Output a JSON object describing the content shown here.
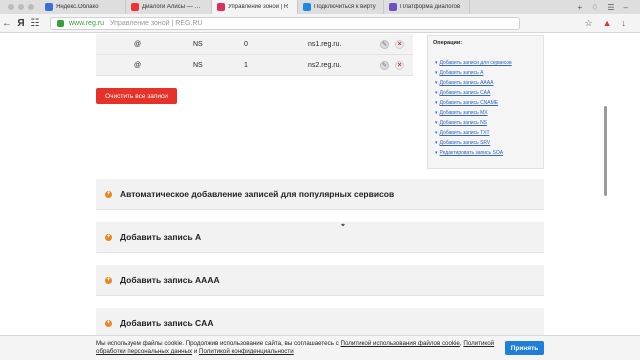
{
  "browser": {
    "tabs": [
      {
        "label": "Яндекс.Облако",
        "fav_color": "#3a6fd8"
      },
      {
        "label": "Диалоги Алисы — Обл",
        "fav_color": "#e33"
      },
      {
        "label": "Управление зоной | R",
        "fav_color": "#d9305c",
        "active": true
      },
      {
        "label": "Подключиться к вирту",
        "fav_color": "#1e88e5"
      },
      {
        "label": "Платформа диалогов",
        "fav_color": "#6a4fc8"
      }
    ],
    "url_domain": "www.reg.ru",
    "page_title": "Управление зоной | REG.RU",
    "yandex_logo": "Я"
  },
  "dns_records": [
    {
      "subdomain": "@",
      "type": "NS",
      "priority": "0",
      "value": "ns1.reg.ru."
    },
    {
      "subdomain": "@",
      "type": "NS",
      "priority": "1",
      "value": "ns2.reg.ru."
    }
  ],
  "clear_button": "Очистить все записи",
  "operations": {
    "title": "Операции:",
    "items": [
      "Добавить записи для сервисов",
      "Добавить запись A",
      "Добавить запись AAAA",
      "Добавить запись CAA",
      "Добавить запись CNAME",
      "Добавить запись MX",
      "Добавить запись NS",
      "Добавить запись TXT",
      "Добавить запись SRV",
      "Редактировать запись SOA"
    ]
  },
  "sections": [
    {
      "title": "Автоматическое добавление записей для популярных сервисов"
    },
    {
      "title": "Добавить запись A"
    },
    {
      "title": "Добавить запись AAAA"
    },
    {
      "title": "Добавить запись CAA"
    }
  ],
  "cookie_banner": {
    "text1": "Мы используем файлы cookie. Продолжив использование сайта, вы соглашаетесь с",
    "link1": "Политикой использования файлов cookie",
    "comma": ",",
    "link2": "Политикой обработки персональных данных",
    "and": "и",
    "link3": "Политикой конфиденциальности",
    "accept": "Принять"
  }
}
